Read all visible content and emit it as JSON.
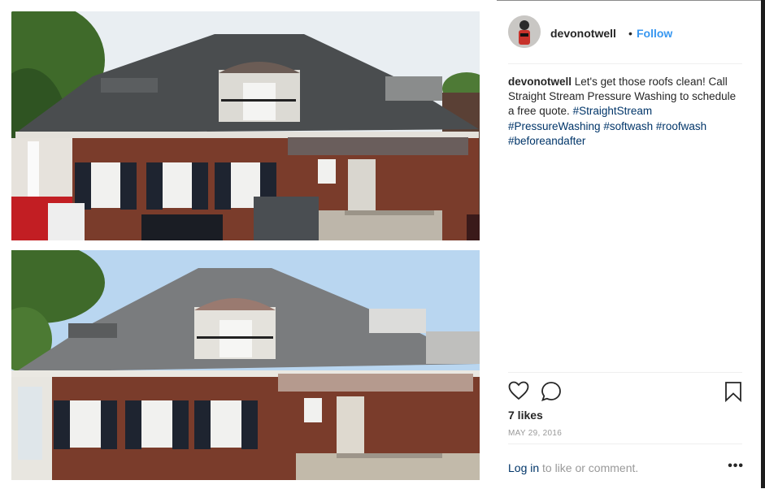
{
  "post": {
    "username": "devonotwell",
    "separator": "•",
    "follow_label": "Follow",
    "caption": {
      "username": "devonotwell",
      "text": "Let's get those roofs clean! Call Straight Stream Pressure Washing to schedule a free quote.",
      "hashtags": [
        "#StraightStream",
        "#PressureWashing",
        "#softwash",
        "#roofwash",
        "#beforeandafter"
      ]
    },
    "likes": "7 likes",
    "date": "MAY 29, 2016",
    "login_link": "Log in",
    "login_rest": "to like or comment.",
    "more_label": "•••"
  },
  "icons": {
    "like": "heart-icon",
    "comment": "comment-icon",
    "save": "bookmark-icon",
    "more": "more-options-icon"
  },
  "colors": {
    "link_blue": "#3897f0",
    "hashtag": "#003569",
    "muted": "#999999",
    "text": "#262626",
    "border": "#efefef"
  }
}
